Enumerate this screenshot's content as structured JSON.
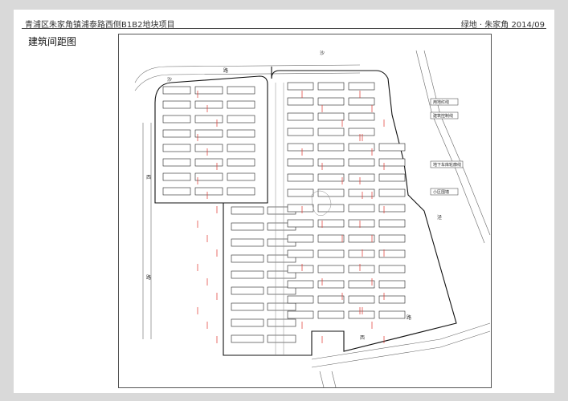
{
  "header": {
    "project_title": "青浦区朱家角镇浦泰路西侧B1B2地块项目",
    "company_date": "绿地 · 朱家角   2014/09"
  },
  "section": {
    "title": "建筑间距图"
  },
  "plan": {
    "legend": [
      "用地红线",
      "建筑控制线",
      "地下车库轮廓线",
      "小区围墙"
    ],
    "road_labels": [
      "沙",
      "路",
      "西",
      "路",
      "沙",
      "泾",
      "路",
      "西"
    ]
  },
  "colors": {
    "page_bg": "#d9d9d9",
    "sheet_bg": "#ffffff",
    "line": "#333333",
    "dimension_red": "#e0322b"
  }
}
